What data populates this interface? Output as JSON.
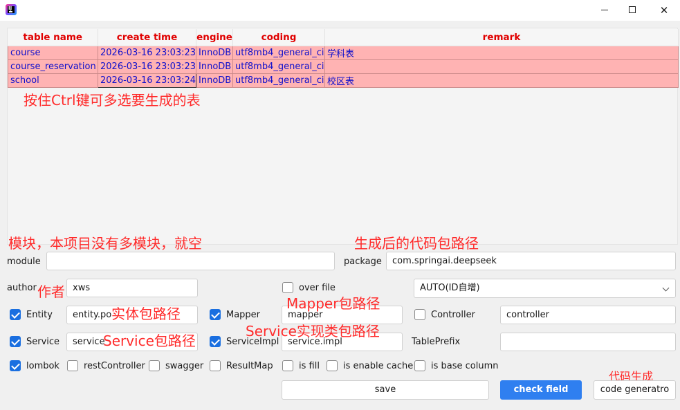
{
  "table": {
    "headers": [
      "table name",
      "create time",
      "engine",
      "coding",
      "remark"
    ],
    "rows": [
      [
        "course",
        "2026-03-16 23:03:23",
        "InnoDB",
        "utf8mb4_general_ci",
        "学科表"
      ],
      [
        "course_reservation",
        "2026-03-16 23:03:23",
        "InnoDB",
        "utf8mb4_general_ci",
        ""
      ],
      [
        "school",
        "2026-03-16 23:03:24",
        "InnoDB",
        "utf8mb4_general_ci",
        "校区表"
      ]
    ]
  },
  "notes": {
    "multi_select": "按住Ctrl键可多选要生成的表",
    "module": "模块，本项目没有多模块，就空",
    "package": "生成后的代码包路径",
    "author": "作者",
    "entity": "实体包路径",
    "mapper": "Mapper包路径",
    "service": "Service包路径",
    "service_impl": "Service实现类包路径",
    "generate": "代码生成"
  },
  "form": {
    "module_label": "module",
    "module_value": "",
    "package_label": "package",
    "package_value": "com.springai.deepseek",
    "author_label": "author",
    "author_value": "xws",
    "over_file_label": "over file",
    "over_file_checked": false,
    "id_strategy": "AUTO(ID自增)",
    "entity_label": "Entity",
    "entity_checked": true,
    "entity_value": "entity.po",
    "mapper_label": "Mapper",
    "mapper_checked": true,
    "mapper_value": "mapper",
    "controller_label": "Controller",
    "controller_checked": false,
    "controller_value": "controller",
    "service_label": "Service",
    "service_checked": true,
    "service_value": "service",
    "service_impl_label": "ServiceImpl",
    "service_impl_checked": true,
    "service_impl_value": "service.impl",
    "table_prefix_label": "TablePrefix",
    "table_prefix_value": ""
  },
  "options": [
    {
      "label": "lombok",
      "checked": true
    },
    {
      "label": "restController",
      "checked": false
    },
    {
      "label": "swagger",
      "checked": false
    },
    {
      "label": "ResultMap",
      "checked": false
    },
    {
      "label": "is fill",
      "checked": false
    },
    {
      "label": "is enable cache",
      "checked": false
    },
    {
      "label": "is base column",
      "checked": false
    }
  ],
  "buttons": {
    "save": "save",
    "check_field": "check field",
    "code_generator": "code generatro"
  },
  "window": {
    "close_glyph": "✕",
    "min_glyph": "",
    "max_glyph": ""
  },
  "colors": {
    "header_text": "#e00000",
    "row_bg": "#ffb3b3",
    "row_text": "#1010cc",
    "note_text": "#ff2a2a",
    "checkbox_on": "#1a6fe0",
    "primary_button": "#2f7ff0"
  },
  "icons": {
    "app": "intellij-idea-icon",
    "minimize": "minimize-icon",
    "maximize": "maximize-icon",
    "close": "close-icon",
    "dropdown": "chevron-down-icon",
    "check": "checkmark-icon"
  }
}
